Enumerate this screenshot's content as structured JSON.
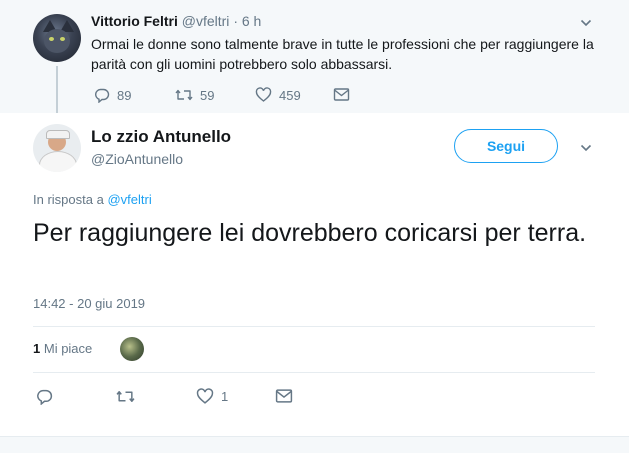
{
  "parent_tweet": {
    "author_name": "Vittorio Feltri",
    "handle": "@vfeltri",
    "time": "· 6 h",
    "text": "Ormai le donne sono talmente brave in tutte le professioni che per raggiungere la parità con gli uomini potrebbero solo  abbassarsi.",
    "replies": "89",
    "retweets": "59",
    "likes": "459"
  },
  "main_tweet": {
    "author_name": "Lo zzio Antunello",
    "handle": "@ZioAntunello",
    "follow_label": "Segui",
    "reply_prefix": "In risposta a",
    "reply_handle": "@vfeltri",
    "text": "Per raggiungere lei dovrebbero coricarsi per terra.",
    "timestamp": "14:42 - 20 giu 2019",
    "likes_count": "1",
    "likes_label": "Mi piace",
    "action_likes": "1"
  },
  "icons": {
    "reply": "reply-icon",
    "retweet": "retweet-icon",
    "like": "heart-icon",
    "dm": "envelope-icon",
    "caret": "chevron-down-icon"
  },
  "colors": {
    "accent": "#1da1f2",
    "muted": "#657786",
    "text": "#14171a",
    "parent_bg": "#f5f8fa"
  }
}
